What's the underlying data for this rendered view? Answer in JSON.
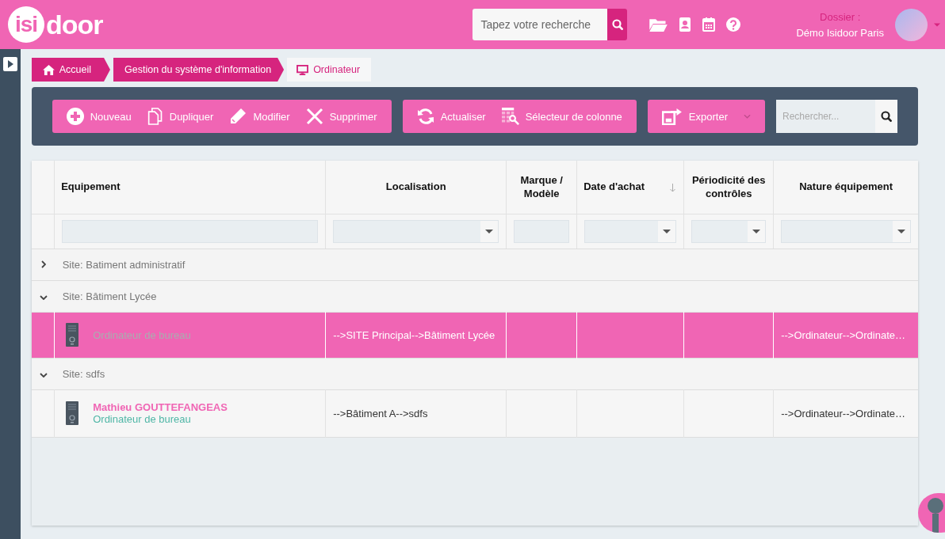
{
  "header": {
    "logo": {
      "circle_text": "isi",
      "text": "door"
    },
    "search": {
      "placeholder": "Tapez votre recherche"
    },
    "dossier": {
      "label": "Dossier :",
      "value": "Démo Isidoor Paris"
    }
  },
  "breadcrumb": [
    {
      "label": "Accueil",
      "selected": false
    },
    {
      "label": "Gestion du système d'information",
      "selected": false
    },
    {
      "label": "Ordinateur",
      "selected": true
    }
  ],
  "toolbar": {
    "groups": [
      [
        {
          "label": "Nouveau"
        },
        {
          "label": "Dupliquer"
        },
        {
          "label": "Modifier"
        },
        {
          "label": "Supprimer"
        }
      ],
      [
        {
          "label": "Actualiser"
        },
        {
          "label": "Sélecteur de colonne"
        }
      ],
      [
        {
          "label": "Exporter",
          "dropdown": true
        }
      ]
    ],
    "search": {
      "placeholder": "Rechercher..."
    }
  },
  "table": {
    "columns": [
      {
        "label": "Equipement",
        "kind": "text"
      },
      {
        "label": "Localisation",
        "kind": "select"
      },
      {
        "label": "Marque / Modèle",
        "kind": "text"
      },
      {
        "label": "Date d'achat",
        "kind": "select",
        "sorted": true
      },
      {
        "label": "Périodicité des contrôles",
        "kind": "select"
      },
      {
        "label": "Nature équipement",
        "kind": "select"
      }
    ],
    "rows": [
      {
        "kind": "group",
        "label": "Site: Batiment administratif",
        "expanded": false
      },
      {
        "kind": "group",
        "label": "Site: Bâtiment Lycée",
        "expanded": true
      },
      {
        "kind": "item",
        "selected": true,
        "name": "Ordinateur de bureau",
        "cells": [
          "-->SITE Principal-->Bâtiment Lycée",
          "",
          "",
          "",
          "-->Ordinateur-->Ordinate…"
        ]
      },
      {
        "kind": "group",
        "label": "Site: sdfs",
        "expanded": true
      },
      {
        "kind": "item",
        "selected": false,
        "owner": "Mathieu GOUTTEFANGEAS",
        "name": "Ordinateur de bureau",
        "cells": [
          "-->Bâtiment A-->sdfs",
          "",
          "",
          "",
          "-->Ordinateur-->Ordinate…"
        ]
      }
    ]
  }
}
